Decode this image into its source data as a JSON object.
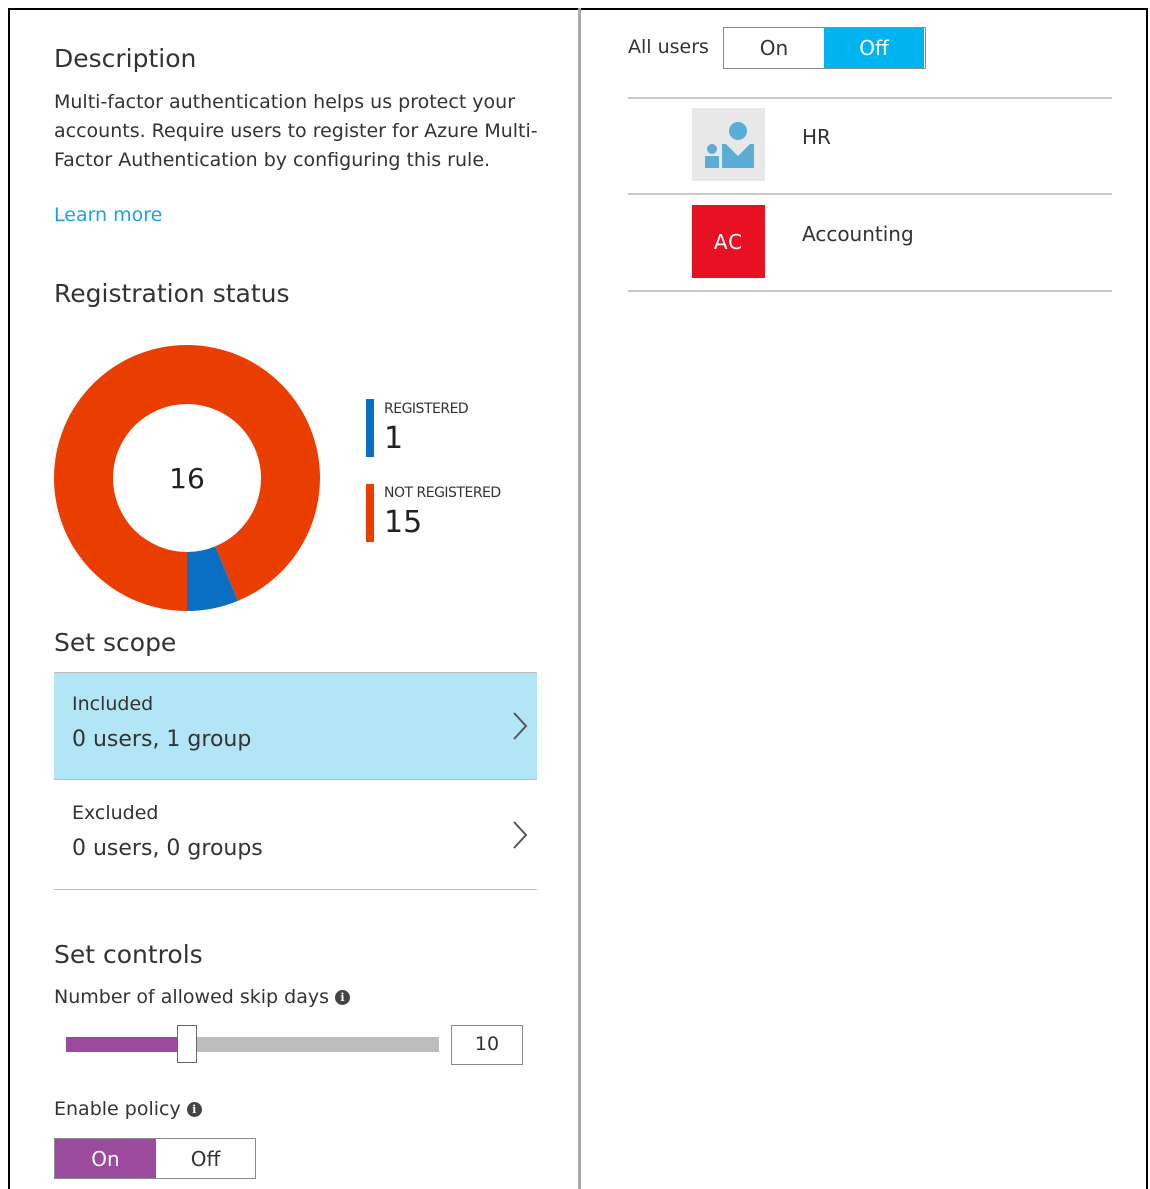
{
  "description": {
    "heading": "Description",
    "body": "Multi-factor authentication helps us protect your accounts. Require users to register for Azure Multi-Factor Authentication by configuring this rule.",
    "learn_more": "Learn more"
  },
  "registration": {
    "heading": "Registration status",
    "total": "16",
    "registered_label": "REGISTERED",
    "registered_value": "1",
    "not_registered_label": "NOT REGISTERED",
    "not_registered_value": "15",
    "colors": {
      "registered": "#0a6fc2",
      "not_registered": "#ea3e00"
    }
  },
  "scope": {
    "heading": "Set scope",
    "included_label": "Included",
    "included_value": "0 users, 1 group",
    "excluded_label": "Excluded",
    "excluded_value": "0 users, 0 groups"
  },
  "controls": {
    "heading": "Set controls",
    "skip_days_label": "Number of allowed skip days",
    "skip_days_value": "10",
    "enable_policy_label": "Enable policy",
    "enable_on": "On",
    "enable_off": "Off",
    "enable_selected": "On"
  },
  "all_users": {
    "label": "All users",
    "on": "On",
    "off": "Off",
    "selected": "Off"
  },
  "groups": [
    {
      "name": "HR",
      "icon": "group-icon"
    },
    {
      "name": "Accounting",
      "initials": "AC",
      "color": "#e81123"
    }
  ]
}
